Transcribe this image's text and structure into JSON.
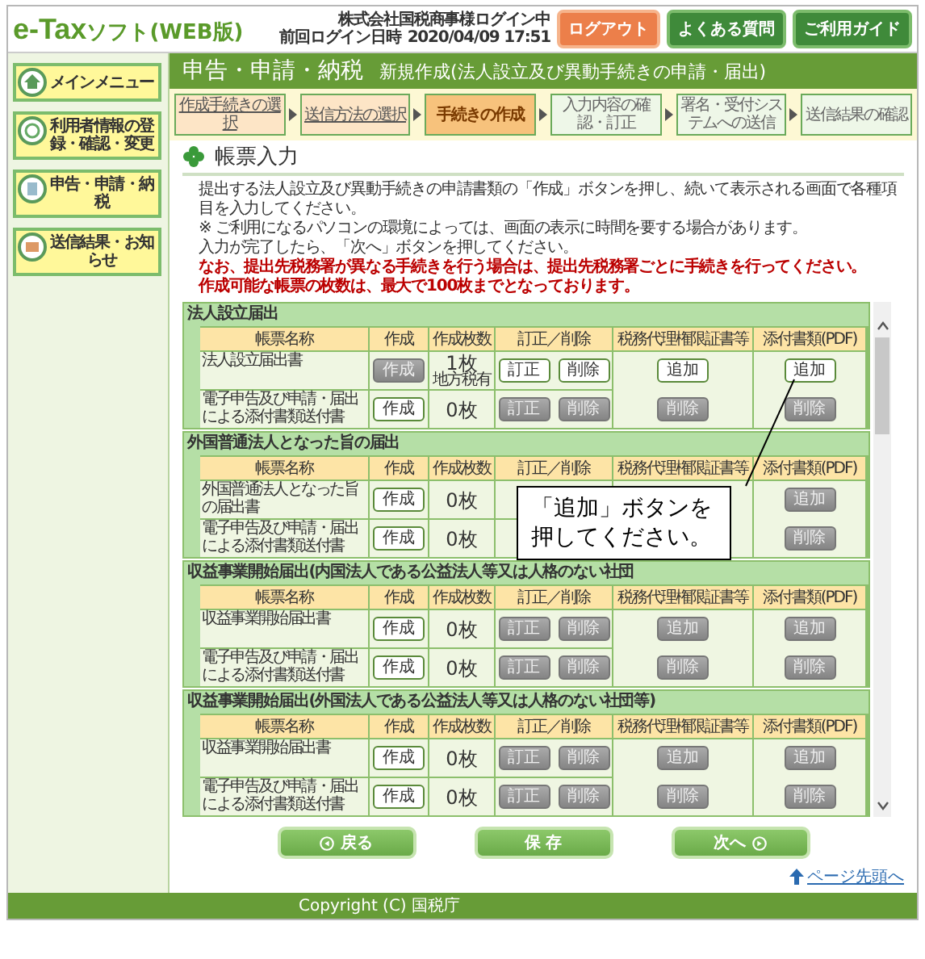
{
  "header": {
    "logo_main": "e-Tax",
    "logo_sub": "ソフト(WEB版)",
    "user": "株式会社国税商事様ログイン中",
    "last_login_label": "前回ログイン日時",
    "last_login": "2020/04/09 17:51",
    "buttons": [
      {
        "label": "ログアウト",
        "kind": "logout"
      },
      {
        "label": "よくある質問",
        "kind": "link"
      },
      {
        "label": "ご利用ガイド",
        "kind": "link"
      }
    ]
  },
  "sidebar": [
    {
      "label": "メインメニュー"
    },
    {
      "label": "利用者情報の登録・確認・変更"
    },
    {
      "label": "申告・申請・納税"
    },
    {
      "label": "送信結果・お知らせ"
    }
  ],
  "title_bar": {
    "title": "申告・申請・納税",
    "subtitle": "新規作成(法人設立及び異動手続きの申請・届出)"
  },
  "steps": [
    {
      "label": "作成手続きの選択",
      "selected": false,
      "completed": true
    },
    {
      "label": "送信方法の選択",
      "selected": false,
      "completed": true
    },
    {
      "label": "手続きの作成",
      "selected": true,
      "completed": false
    },
    {
      "label": "入力内容の確認・訂正",
      "selected": false,
      "completed": false
    },
    {
      "label": "署名・受付システムへの送信",
      "selected": false,
      "completed": false
    },
    {
      "label": "送信結果の確認",
      "selected": false,
      "completed": false
    }
  ],
  "heading": "帳票入力",
  "instructions": [
    {
      "text": "提出する法人設立及び異動手続きの申請書類の「作成」ボタンを押し、続いて表示される画面で各種項目を入力してください。",
      "kind": "normal"
    },
    {
      "text": "※ ご利用になるパソコンの環境によっては、画面の表示に時間を要する場合があります。",
      "kind": "normal"
    },
    {
      "text": "入力が完了したら、「次へ」ボタンを押してください。",
      "kind": "normal"
    },
    {
      "text": "なお、提出先税務署が異なる手続きを行う場合は、提出先税務署ごとに手続きを行ってください。",
      "kind": "warning"
    },
    {
      "text": "作成可能な帳票の枚数は、最大で100枚までとなっております。",
      "kind": "warning"
    }
  ],
  "sections": [
    {
      "title": "法人設立届出",
      "columns": [
        "帳票名称",
        "作成",
        "作成枚数",
        "訂正／削除",
        "税務代理権限証書等",
        "添付書類(PDF)"
      ],
      "rows": [
        {
          "name": "法人設立届出書",
          "create": {
            "label": "作成",
            "enabled": false
          },
          "count": "1枚",
          "count_note": "地方税有",
          "revise": [
            {
              "label": "訂正",
              "enabled": true
            },
            {
              "label": "削除",
              "enabled": true
            }
          ]
        },
        {
          "name": "電子申告及び申請・届出による添付書類送付書",
          "create": {
            "label": "作成",
            "enabled": true
          },
          "count": "0枚",
          "revise": [
            {
              "label": "訂正",
              "enabled": false
            },
            {
              "label": "削除",
              "enabled": false
            }
          ]
        }
      ],
      "agent": [
        {
          "label": "追加",
          "enabled": true
        },
        {
          "label": "削除",
          "enabled": false
        }
      ],
      "attachments": [
        {
          "label": "追加",
          "enabled": true
        },
        {
          "label": "削除",
          "enabled": false
        }
      ]
    },
    {
      "title": "外国普通法人となった旨の届出",
      "columns": [
        "帳票名称",
        "作成",
        "作成枚数",
        "訂正／削除",
        "税務代理権限証書等",
        "添付書類(PDF)"
      ],
      "rows": [
        {
          "name": "外国普通法人となった旨の届出書",
          "create": {
            "label": "作成",
            "enabled": true
          },
          "count": "0枚"
        },
        {
          "name": "電子申告及び申請・届出による添付書類送付書",
          "create": {
            "label": "作成",
            "enabled": true
          },
          "count": "0枚"
        }
      ],
      "attachments": [
        {
          "label": "追加",
          "enabled": false
        },
        {
          "label": "削除",
          "enabled": false
        }
      ],
      "callout": "「追加」ボタンを押してください。"
    },
    {
      "title": "収益事業開始届出(内国法人である公益法人等又は人格のない社団",
      "columns": [
        "帳票名称",
        "作成",
        "作成枚数",
        "訂正／削除",
        "税務代理権限証書等",
        "添付書類(PDF)"
      ],
      "rows": [
        {
          "name": "収益事業開始届出書",
          "create": {
            "label": "作成",
            "enabled": true
          },
          "count": "0枚",
          "revise": [
            {
              "label": "訂正",
              "enabled": false
            },
            {
              "label": "削除",
              "enabled": false
            }
          ]
        },
        {
          "name": "電子申告及び申請・届出による添付書類送付書",
          "create": {
            "label": "作成",
            "enabled": true
          },
          "count": "0枚",
          "revise": [
            {
              "label": "訂正",
              "enabled": false
            },
            {
              "label": "削除",
              "enabled": false
            }
          ]
        }
      ],
      "agent": [
        {
          "label": "追加",
          "enabled": false
        },
        {
          "label": "削除",
          "enabled": false
        }
      ],
      "attachments": [
        {
          "label": "追加",
          "enabled": false
        },
        {
          "label": "削除",
          "enabled": false
        }
      ]
    },
    {
      "title": "収益事業開始届出(外国法人である公益法人等又は人格のない社団等)",
      "columns": [
        "帳票名称",
        "作成",
        "作成枚数",
        "訂正／削除",
        "税務代理権限証書等",
        "添付書類(PDF)"
      ],
      "rows": [
        {
          "name": "収益事業開始届出書",
          "create": {
            "label": "作成",
            "enabled": true
          },
          "count": "0枚",
          "revise": [
            {
              "label": "訂正",
              "enabled": false
            },
            {
              "label": "削除",
              "enabled": false
            }
          ]
        },
        {
          "name": "電子申告及び申請・届出による添付書類送付書",
          "create": {
            "label": "作成",
            "enabled": true
          },
          "count": "0枚",
          "revise": [
            {
              "label": "訂正",
              "enabled": false
            },
            {
              "label": "削除",
              "enabled": false
            }
          ]
        }
      ],
      "agent": [
        {
          "label": "追加",
          "enabled": false
        },
        {
          "label": "削除",
          "enabled": false
        }
      ],
      "attachments": [
        {
          "label": "追加",
          "enabled": false
        },
        {
          "label": "削除",
          "enabled": false
        }
      ]
    }
  ],
  "nav_buttons": [
    {
      "label": "戻る",
      "kind": "back"
    },
    {
      "label": "保 存",
      "kind": "save"
    },
    {
      "label": "次へ",
      "kind": "next"
    }
  ],
  "page_top": "ページ先頭へ",
  "footer": "Copyright (C) 国税庁"
}
